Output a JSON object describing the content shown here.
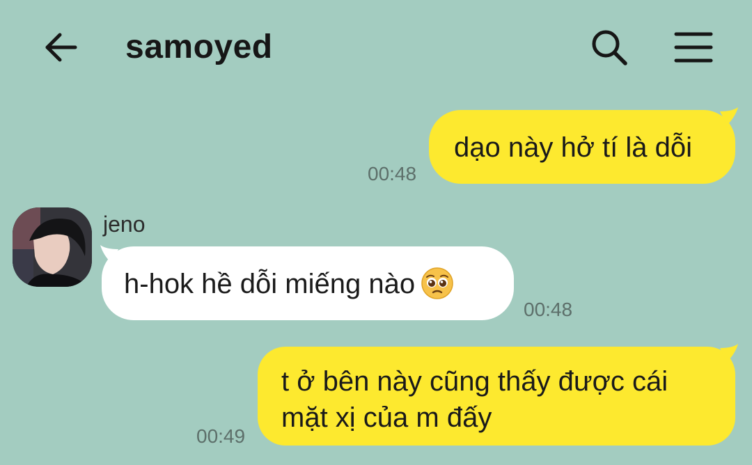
{
  "header": {
    "title": "samoyed",
    "back_icon": "arrow-left-icon",
    "search_icon": "search-icon",
    "menu_icon": "hamburger-menu-icon"
  },
  "messages": [
    {
      "direction": "outgoing",
      "lines": [
        "dạo này hở tí là dỗi"
      ],
      "time": "00:48"
    },
    {
      "direction": "incoming",
      "sender": "jeno",
      "text": "h-hok hề dỗi miếng nào",
      "emoji": "pleading-face-emoji",
      "time": "00:48"
    },
    {
      "direction": "outgoing",
      "lines": [
        "t ở bên này cũng thấy được cái",
        "mặt xị của m đấy"
      ],
      "time": "00:49"
    }
  ],
  "colors": {
    "background": "#a3ccc0",
    "outgoing_bubble": "#fde92f",
    "incoming_bubble": "#ffffff",
    "timestamp": "#5d6f6a"
  }
}
